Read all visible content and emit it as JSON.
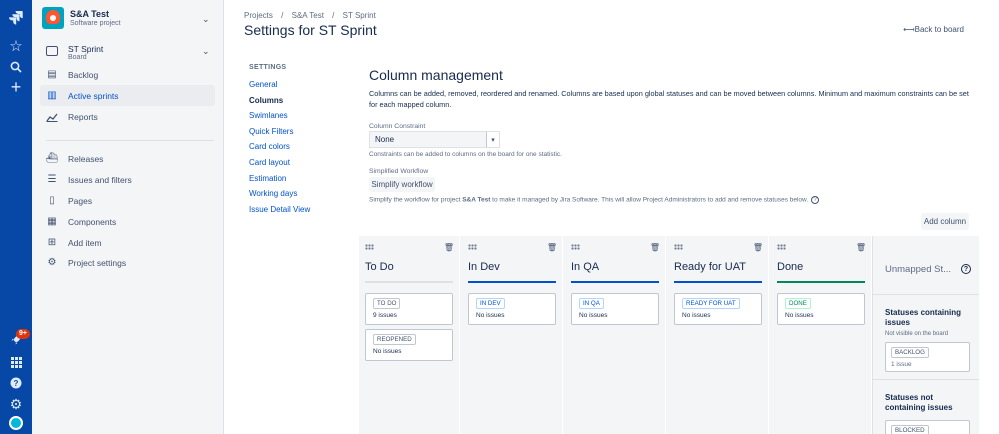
{
  "project": {
    "name": "S&A Test",
    "type": "Software project"
  },
  "board_selector": {
    "name": "ST Sprint",
    "type": "Board"
  },
  "sidebar": {
    "items": [
      {
        "label": "Backlog",
        "icon": "backlog-icon"
      },
      {
        "label": "Active sprints",
        "icon": "board-icon",
        "active": true
      },
      {
        "label": "Reports",
        "icon": "reports-icon"
      },
      {
        "label": "Releases",
        "icon": "ship-icon"
      },
      {
        "label": "Issues and filters",
        "icon": "issues-icon"
      },
      {
        "label": "Pages",
        "icon": "page-icon"
      },
      {
        "label": "Components",
        "icon": "component-icon"
      },
      {
        "label": "Add item",
        "icon": "add-item-icon"
      },
      {
        "label": "Project settings",
        "icon": "gear-icon"
      }
    ]
  },
  "global_nav": {
    "notification_badge": "9+"
  },
  "breadcrumbs": [
    "Projects",
    "/",
    "S&A Test",
    "/",
    "ST Sprint"
  ],
  "page_title": "Settings for ST Sprint",
  "back_link": "Back to board",
  "settings_nav": {
    "heading": "SETTINGS",
    "links": [
      "General",
      "Columns",
      "Swimlanes",
      "Quick Filters",
      "Card colors",
      "Card layout",
      "Estimation",
      "Working days",
      "Issue Detail View"
    ],
    "selected": "Columns"
  },
  "column_management": {
    "title": "Column management",
    "description": "Columns can be added, removed, reordered and renamed. Columns are based upon global statuses and can be moved between columns. Minimum and maximum constraints can be set for each mapped column.",
    "constraint_label": "Column Constraint",
    "constraint_value": "None",
    "constraint_help": "Constraints can be added to columns on the board for one statistic.",
    "workflow_label": "Simplified Workflow",
    "workflow_button": "Simplify workflow",
    "workflow_help_pre": "Simplify the workflow for project ",
    "workflow_help_project": "S&A Test",
    "workflow_help_post": " to make it managed by Jira Software. This will allow Project Administrators to add and remove statuses below.",
    "add_column_button": "Add column"
  },
  "columns": [
    {
      "name": "To Do",
      "bar_color": "#dfe1e6",
      "statuses": [
        {
          "label": "TO DO",
          "count": "9 issues",
          "color": "#42526e"
        },
        {
          "label": "REOPENED",
          "count": "No issues",
          "color": "#42526e"
        }
      ]
    },
    {
      "name": "In Dev",
      "bar_color": "#0052cc",
      "statuses": [
        {
          "label": "IN DEV",
          "count": "No issues",
          "color": "#0052cc"
        }
      ]
    },
    {
      "name": "In QA",
      "bar_color": "#0052cc",
      "statuses": [
        {
          "label": "IN QA",
          "count": "No issues",
          "color": "#0052cc"
        }
      ]
    },
    {
      "name": "Ready for UAT",
      "bar_color": "#0052cc",
      "statuses": [
        {
          "label": "READY FOR UAT",
          "count": "No issues",
          "color": "#0052cc"
        }
      ]
    },
    {
      "name": "Done",
      "bar_color": "#00875a",
      "statuses": [
        {
          "label": "DONE",
          "count": "No issues",
          "color": "#00875a"
        }
      ]
    }
  ],
  "unmapped": {
    "title": "Unmapped St...",
    "containing_title": "Statuses containing issues",
    "containing_sub": "Not visible on the board",
    "containing_status": {
      "label": "BACKLOG",
      "count": "1 issue"
    },
    "not_containing_title": "Statuses not containing issues",
    "not_containing_status": {
      "label": "BLOCKED"
    }
  }
}
